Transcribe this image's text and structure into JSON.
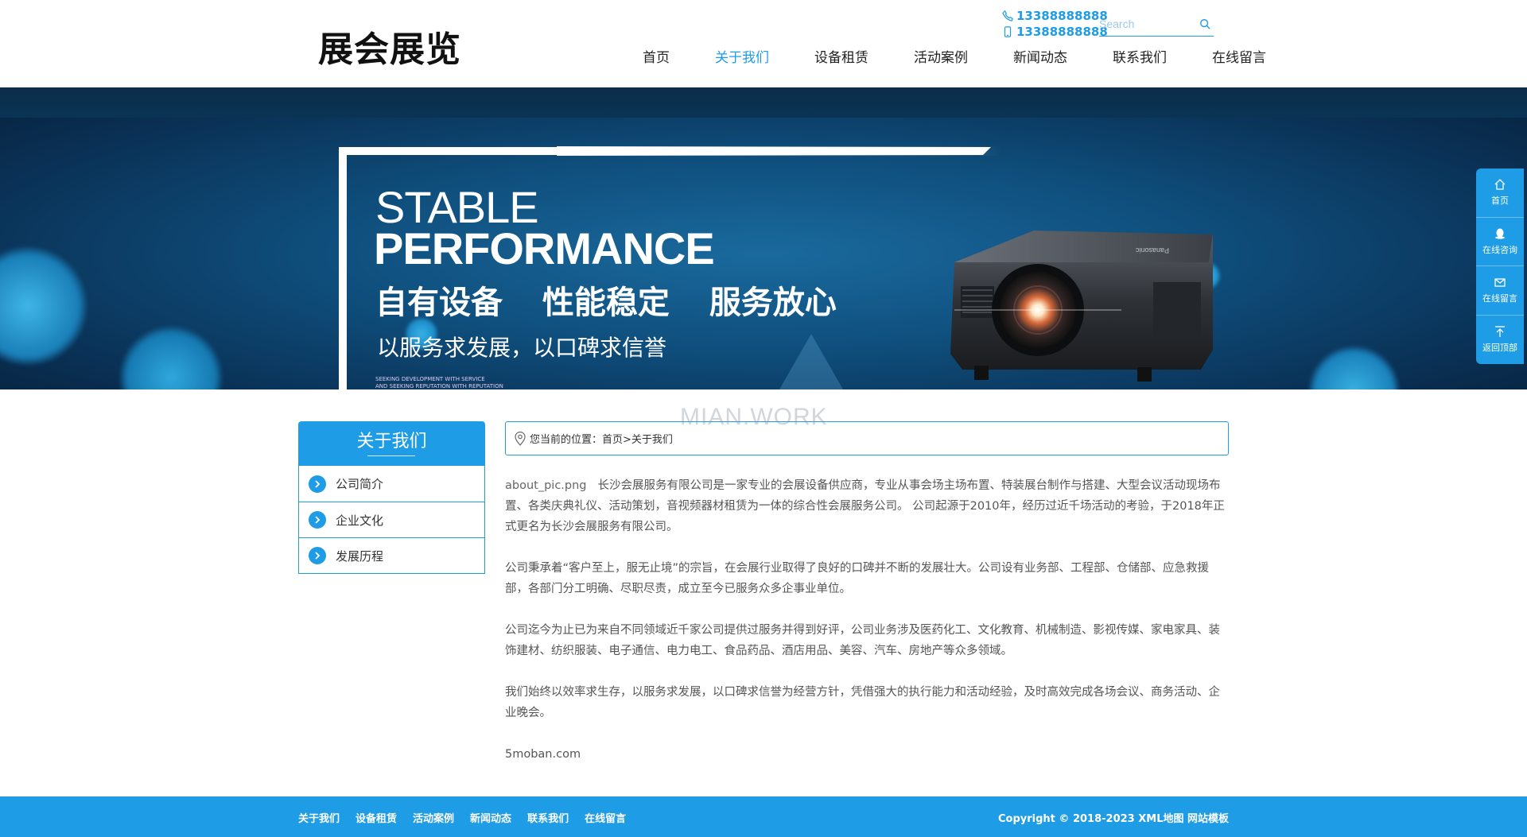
{
  "header": {
    "logo": "展会展览",
    "phone1": "13388888888",
    "phone2": "13388888888",
    "search_placeholder": "Search",
    "nav": [
      {
        "label": "首页"
      },
      {
        "label": "关于我们"
      },
      {
        "label": "设备租赁"
      },
      {
        "label": "活动案例"
      },
      {
        "label": "新闻动态"
      },
      {
        "label": "联系我们"
      },
      {
        "label": "在线留言"
      }
    ],
    "active_nav": "关于我们"
  },
  "banner": {
    "en_line1": "STABLE",
    "en_line2": "PERFORMANCE",
    "cn_line1": "自有设备 性能稳定 服务放心",
    "cn_line2": "以服务求发展，以口碑求信誉",
    "small_line1": "SEEKING DEVELOPMENT WITH SERVICE",
    "small_line2": "AND SEEKING REPUTATION WITH REPUTATION",
    "projector_brand": "Panasonic"
  },
  "side_float": [
    {
      "label": "首页",
      "icon": "home-icon"
    },
    {
      "label": "在线咨询",
      "icon": "qq-icon"
    },
    {
      "label": "在线留言",
      "icon": "mail-icon"
    },
    {
      "label": "返回顶部",
      "icon": "back-to-top-icon"
    }
  ],
  "watermark": "MIAN.WORK",
  "sidebar": {
    "title": "关于我们",
    "items": [
      {
        "label": "公司简介"
      },
      {
        "label": "企业文化"
      },
      {
        "label": "发展历程"
      }
    ]
  },
  "breadcrumb": {
    "text": "您当前的位置：首页>关于我们"
  },
  "content": {
    "image_alt": "about_pic.png",
    "p1": "长沙会展服务有限公司是一家专业的会展设备供应商，专业从事会场主场布置、特装展台制作与搭建、大型会议活动现场布置、各类庆典礼仪、活动策划，音视频器材租赁为一体的综合性会展服务公司。 公司起源于2010年，经历过近千场活动的考验，于2018年正式更名为长沙会展服务有限公司。",
    "p2": "公司秉承着“客户至上，服无止境”的宗旨，在会展行业取得了良好的口碑并不断的发展壮大。公司设有业务部、工程部、仓储部、应急救援部，各部门分工明确、尽职尽责，成立至今已服务众多企事业单位。",
    "p3": "公司迄今为止已为来自不同领域近千家公司提供过服务并得到好评，公司业务涉及医药化工、文化教育、机械制造、影视传媒、家电家具、装饰建材、纺织服装、电子通信、电力电工、食品药品、酒店用品、美容、汽车、房地产等众多领域。",
    "p4": "我们始终以效率求生存，以服务求发展，以口碑求信誉为经营方针，凭借强大的执行能力和活动经验，及时高效完成各场会议、商务活动、企业晚会。",
    "p5": "5moban.com"
  },
  "footer": {
    "links": [
      {
        "label": "关于我们"
      },
      {
        "label": "设备租赁"
      },
      {
        "label": "活动案例"
      },
      {
        "label": "新闻动态"
      },
      {
        "label": "联系我们"
      },
      {
        "label": "在线留言"
      }
    ],
    "copyright": "Copyright © 2018-2023 XML地图 网站模板"
  },
  "colors": {
    "accent": "#1e9ce6",
    "footer_bg": "#1e9ce6",
    "banner_dark": "#0a3257"
  }
}
